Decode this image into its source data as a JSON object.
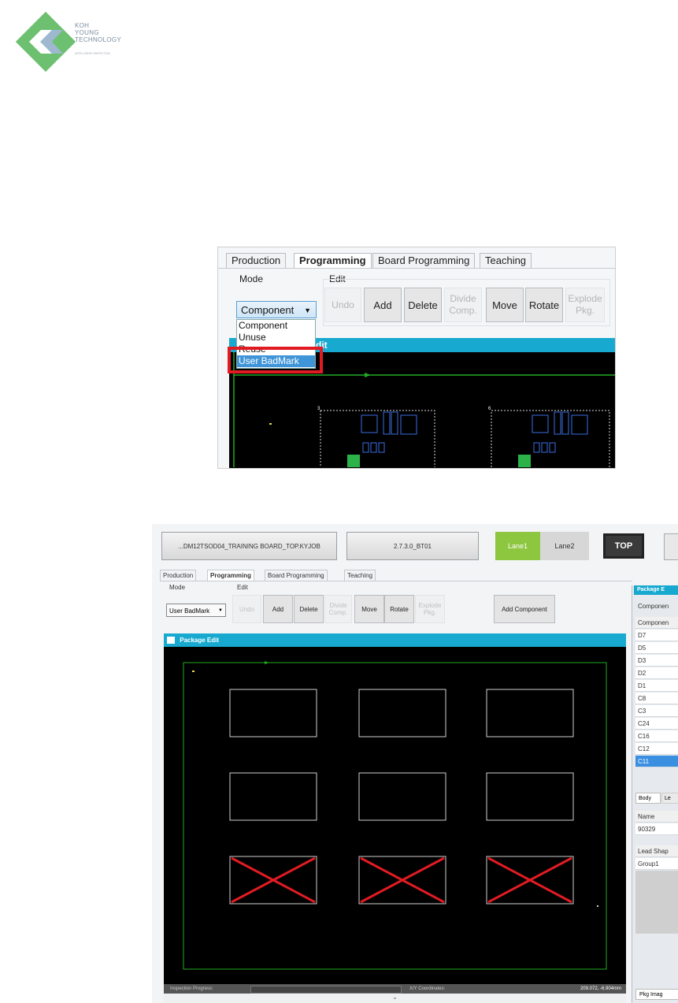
{
  "logo": {
    "line1": "KOH",
    "line2": "YOUNG",
    "line3": "TECHNOLOGY",
    "tagline": "INTELLIGENT INSPECTION"
  },
  "shot1": {
    "tabs": [
      "Production",
      "Programming",
      "Board Programming",
      "Teaching"
    ],
    "mode_label": "Mode",
    "edit_label": "Edit",
    "mode_value": "Component",
    "dropdown": [
      "Component",
      "Unuse",
      "Reuse",
      "User BadMark"
    ],
    "buttons": {
      "undo": "Undo",
      "add": "Add",
      "delete": "Delete",
      "divide": "Divide Comp.",
      "move": "Move",
      "rotate": "Rotate",
      "explode": "Explode Pkg."
    },
    "pe_title": "dit",
    "board_marks": [
      "3",
      "6"
    ]
  },
  "shot2": {
    "job": "...DM12TSOD04_TRAINING BOARD_TOP.KYJOB",
    "version": "2.7.3.0_BT01",
    "lane1": "Lane1",
    "lane2": "Lane2",
    "top": "TOP",
    "tabs": [
      "Production",
      "Programming",
      "Board Programming",
      "Teaching"
    ],
    "mode_label": "Mode",
    "edit_label": "Edit",
    "mode_value": "User BadMark",
    "buttons": {
      "undo": "Undo",
      "add": "Add",
      "delete": "Delete",
      "divide": "Divide Comp.",
      "move": "Move",
      "rotate": "Rotate",
      "explode": "Explode Pkg.",
      "add_component": "Add Component"
    },
    "pe_title": "Package Edit",
    "status_progress": "Inspection Progress:",
    "status_xy": "X/Y Coordinates:",
    "status_coords": "209.072, -6.904mm",
    "panel_title": "Package E",
    "panel_tab": "Componen",
    "panel_header": "Componen",
    "components": [
      "D7",
      "D5",
      "D3",
      "D2",
      "D1",
      "C8",
      "C3",
      "C24",
      "C16",
      "C12",
      "C11"
    ],
    "selected": "C11",
    "body_tab": "Body",
    "le_tab": "Le",
    "name_header": "Name",
    "name_value": "90329",
    "lead_header": "Lead Shap",
    "lead_value": "Group1",
    "pkg_tab": "Pkg Imag",
    "colors": {
      "accent": "#17a9cf",
      "lane_active": "#8dc63f",
      "badmark": "#e21b23",
      "select": "#3a8fe0"
    }
  }
}
